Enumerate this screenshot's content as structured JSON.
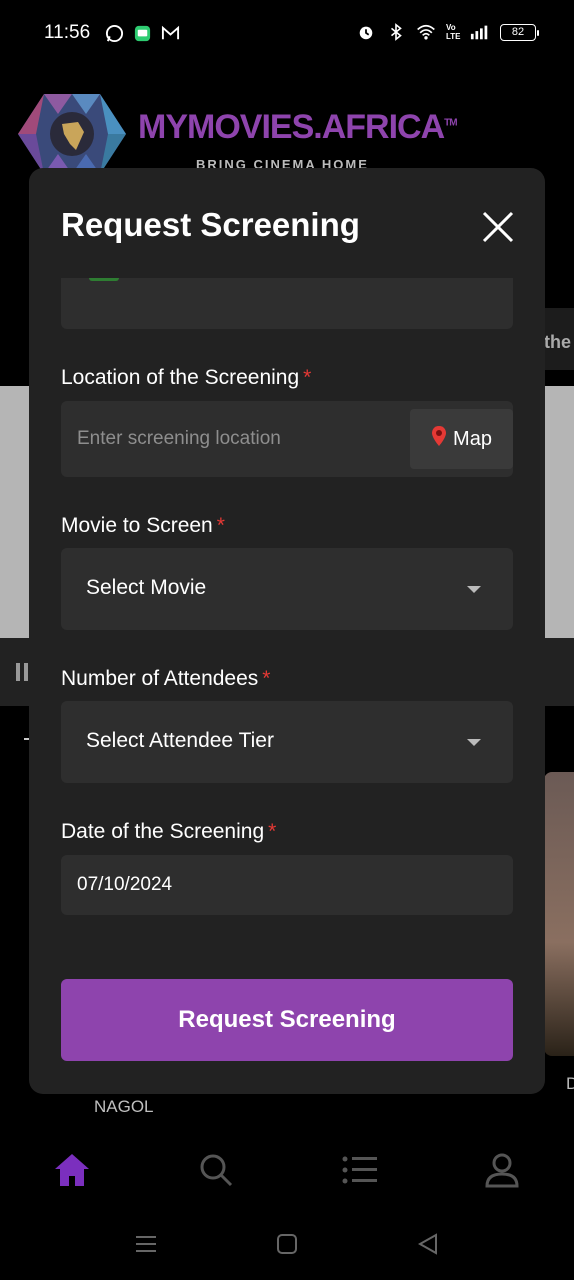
{
  "status_bar": {
    "time": "11:56",
    "battery": "82",
    "network_label": "Vo LTE"
  },
  "background": {
    "brand": "MYMOVIES.AFRICA",
    "tm": "TM",
    "tagline": "BRING CINEMA HOME",
    "side_text": "the",
    "card_caption": "NAGOL",
    "edge_letter": "D"
  },
  "modal": {
    "title": "Request Screening",
    "location": {
      "label": "Location of the Screening",
      "required_mark": "*",
      "placeholder": "Enter screening location",
      "map_button": "Map"
    },
    "movie": {
      "label": "Movie to Screen",
      "required_mark": "*",
      "selected": "Select Movie"
    },
    "attendees": {
      "label": "Number of Attendees",
      "required_mark": "*",
      "selected": "Select Attendee Tier"
    },
    "date": {
      "label": "Date of the Screening",
      "required_mark": "*",
      "value": "07/10/2024"
    },
    "submit_label": "Request Screening"
  },
  "bottom_nav": {
    "active_color": "#8e44ad",
    "items": [
      "home-icon",
      "search-icon",
      "list-icon",
      "profile-icon"
    ]
  },
  "colors": {
    "accent": "#8e44ad",
    "required": "#e53935",
    "modal_bg": "#222222",
    "field_bg": "#2e2e2e"
  }
}
